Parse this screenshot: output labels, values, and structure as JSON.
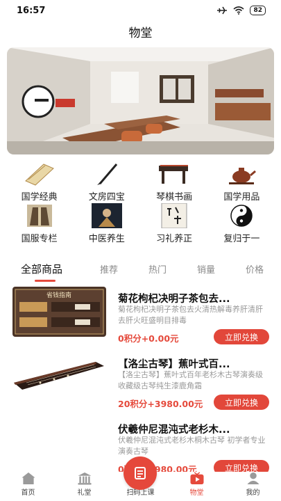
{
  "status_bar": {
    "time": "16:57",
    "battery": "82"
  },
  "header": {
    "title": "物堂"
  },
  "categories": [
    {
      "label": "国学经典",
      "icon": "scroll-icon"
    },
    {
      "label": "文房四宝",
      "icon": "brush-icon"
    },
    {
      "label": "琴棋书画",
      "icon": "guqin-icon"
    },
    {
      "label": "国学用品",
      "icon": "teapot-icon"
    },
    {
      "label": "国服专栏",
      "icon": "robe-icon"
    },
    {
      "label": "中医养生",
      "icon": "herbal-icon"
    },
    {
      "label": "习礼养正",
      "icon": "calligraphy-icon"
    },
    {
      "label": "复归于一",
      "icon": "yinyang-icon"
    }
  ],
  "tabs": [
    {
      "label": "全部商品"
    },
    {
      "label": "推荐"
    },
    {
      "label": "热门"
    },
    {
      "label": "销量"
    },
    {
      "label": "价格"
    }
  ],
  "products": [
    {
      "title": "菊花枸杞决明子茶包去...",
      "desc": "菊花枸杞决明子茶包去火清热解毒养肝清肝去肝火旺盛明目排毒",
      "price": "0积分+0.00元",
      "button": "立即兑换",
      "thumb_text": "省钱指南"
    },
    {
      "title": "【洛尘古琴】蕉叶式百...",
      "desc": "【洛尘古琴】蕉叶式百年老杉木古琴演奏级收藏级古琴纯生漆鹿角霜",
      "price": "20积分+3980.00元",
      "button": "立即兑换"
    },
    {
      "title": "伏羲仲尼混沌式老杉木...",
      "desc": "伏羲仲尼混沌式老杉木桐木古琴 初学者专业演奏古琴",
      "price": "0积分+3980.00元",
      "button": "立即兑换"
    }
  ],
  "bottom_nav": [
    {
      "label": "首页",
      "icon": "home-icon"
    },
    {
      "label": "礼堂",
      "icon": "hall-icon"
    },
    {
      "label": "扫码上课",
      "icon": "scan-icon"
    },
    {
      "label": "物堂",
      "icon": "video-icon"
    },
    {
      "label": "我的",
      "icon": "user-icon"
    }
  ],
  "colors": {
    "accent": "#e54a3c",
    "muted": "#999999"
  }
}
